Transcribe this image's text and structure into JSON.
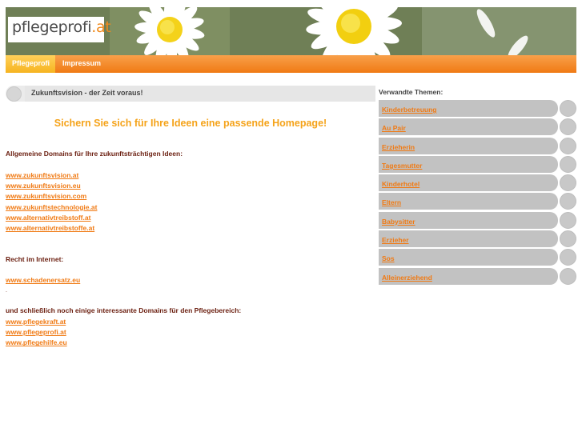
{
  "header": {
    "logo_main": "pflegeprofi",
    "logo_tld": ".at"
  },
  "nav": {
    "items": [
      "Pflegeprofi",
      "Impressum"
    ]
  },
  "main": {
    "heading": "Zukunftsvision - der Zeit voraus!",
    "slogan": "Sichern Sie sich für Ihre Ideen eine passende Homepage!",
    "section1_label": "Allgemeine Domains für Ihre zukunftsträchtigen Ideen:",
    "section1_links": [
      "www.zukunftsvision.at",
      "www.zukunftsvision.eu",
      "www.zukunftsvision.com",
      "www.zukunftstechnologie.at",
      "www.alternativtreibstoff.at",
      "www.alternativtreibstoffe.at"
    ],
    "section2_label": "Recht im Internet:",
    "section2_links": [
      "www.schadenersatz.eu"
    ],
    "dot": ".",
    "section3_label": "und schließlich  noch einige interessante Domains für den Pflegebereich:",
    "section3_links": [
      "www.pflegekraft.at",
      "www.pflegeprofi.at",
      "www.pflegehilfe.eu"
    ]
  },
  "sidebar": {
    "title": "Verwandte Themen:",
    "items": [
      "Kinderbetreuung",
      "Au Pair",
      "Erzieherin",
      "Tagesmutter",
      "Kinderhotel",
      "Eltern",
      "Babysitter",
      "Erzieher",
      "Sos",
      "Alleinerziehend"
    ]
  },
  "colors": {
    "accent_orange": "#f07a14",
    "slogan_yellow": "#f5a31a",
    "label_brown": "#6b1f10",
    "pill_gray": "#c2c2c2"
  }
}
